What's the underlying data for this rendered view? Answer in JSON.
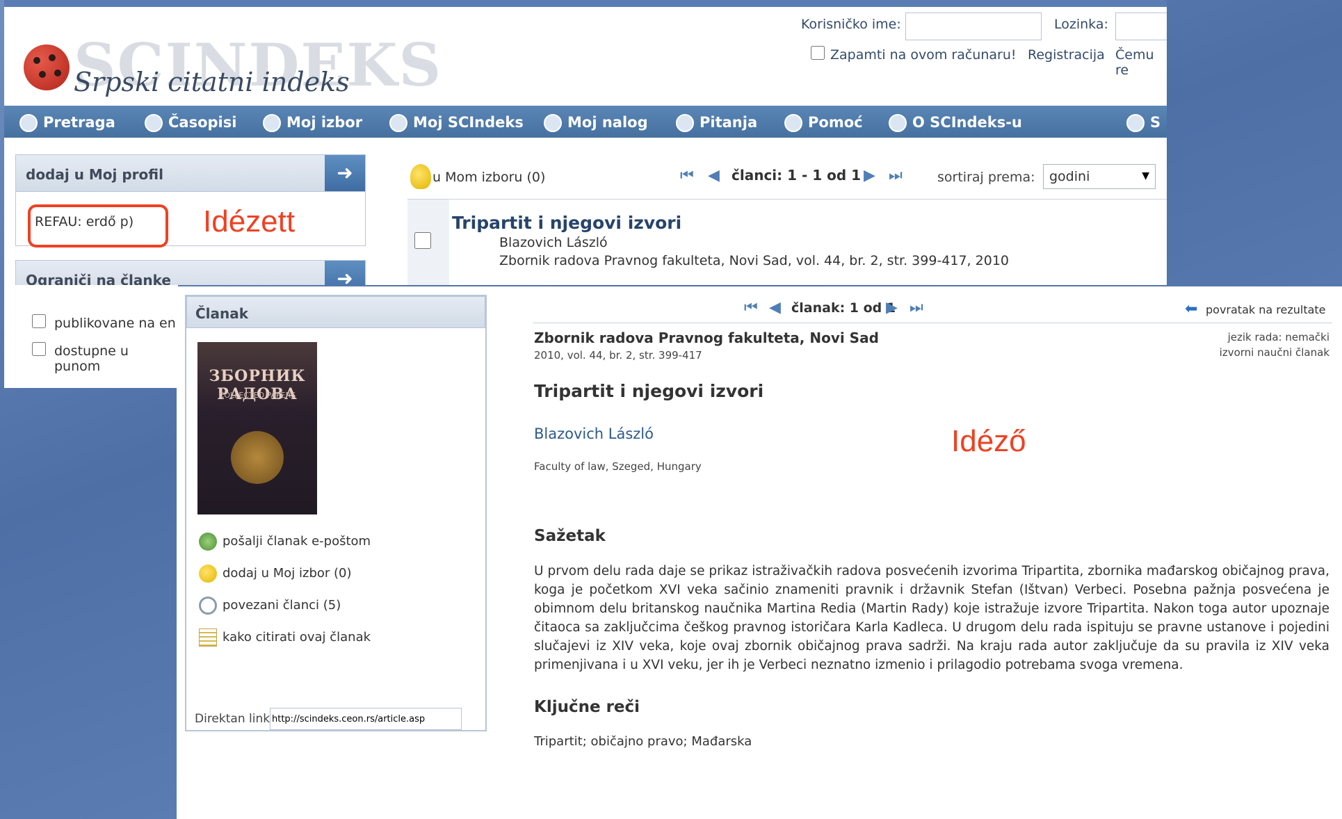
{
  "top": {
    "logo_text": "SCINDEKS",
    "logo_subtitle": "Srpski citatni indeks",
    "login": {
      "username_label": "Korisničko ime:",
      "password_label": "Lozinka:",
      "remember_label": "Zapamti na ovom računaru!",
      "register_link": "Registracija",
      "why_link": "Čemu re"
    },
    "nav": [
      {
        "label": "Pretraga",
        "icon": "magnifier-icon"
      },
      {
        "label": "Časopisi",
        "icon": "books-icon"
      },
      {
        "label": "Moj izbor",
        "icon": "pushpin-icon"
      },
      {
        "label": "Moj SCIndeks",
        "icon": "person-icon"
      },
      {
        "label": "Moj nalog",
        "icon": "account-icon"
      },
      {
        "label": "Pitanja",
        "icon": "question-icon"
      },
      {
        "label": "Pomoć",
        "icon": "plus-help-icon"
      },
      {
        "label": "O SCIndeks-u",
        "icon": "gear-icon"
      },
      {
        "label": "S",
        "icon": "globe-icon"
      }
    ],
    "profile_box": {
      "header": "dodaj u Moj profil",
      "query": "REFAU: erdő p)"
    },
    "limit_box": {
      "header": "Ograniči na članke",
      "options": [
        "publikovane na en",
        "dostupne u punom"
      ]
    },
    "results_toolbar": {
      "selection": "u Mom izboru (0)",
      "pager": "članci: 1 - 1 od 1",
      "sort_label": "sortiraj prema:",
      "sort_value": "godini"
    },
    "result": {
      "title": "Tripartit i njegovi izvori",
      "author": "Blazovich László",
      "source": "Zbornik radova Pravnog fakulteta, Novi Sad, vol. 44, br. 2, str. 399-417, 2010"
    }
  },
  "article": {
    "panel_header": "Članak",
    "cover_title": "ЗБОРНИК РАДОВА",
    "cover_subtitle": "COLLECTED PAPERS",
    "side_links": [
      {
        "label": "pošalji članak e-poštom",
        "icon": "email-person-icon"
      },
      {
        "label": "dodaj u Moj izbor (0)",
        "icon": "pushpin-icon"
      },
      {
        "label": "povezani članci (5)",
        "icon": "link-icon"
      },
      {
        "label": "kako citirati ovaj članak",
        "icon": "document-list-icon"
      }
    ],
    "direct_link_label": "Direktan link",
    "direct_link_value": "http://scindeks.ceon.rs/article.asp",
    "pager": "članak: 1 od 1",
    "back_link": "povratak na rezultate",
    "journal": "Zbornik radova Pravnog fakulteta, Novi Sad",
    "citation": "2010, vol. 44, br. 2, str. 399-417",
    "language": "jezik rada: nemački",
    "type": "izvorni naučni članak",
    "title": "Tripartit i njegovi izvori",
    "author": "Blazovich László",
    "affiliation": "Faculty of law, Szeged, Hungary",
    "abstract_heading": "Sažetak",
    "abstract": "U prvom delu rada daje se prikaz istraživačkih radova posvećenih izvorima Tripartita, zbornika mađarskog običajnog prava, koga je početkom XVI veka sačinio znameniti pravnik i državnik Stefan (Ištvan) Verbeci. Posebna pažnja posvećena je obimnom delu britanskog naučnika Martina Redia (Martin Rady) koje istražuje izvore Tripartita. Nakon toga autor upoznaje čitaoca sa zaključcima češkog pravnog istoričara Karla Kadleca. U drugom delu rada ispituju se pravne ustanove i pojedini slučajevi iz XIV veka, koje ovaj zbornik običajnog prava sadrži. Na kraju rada autor zaključuje da su pravila iz XIV veka primenjivana i u XVI veku, jer ih je Verbeci neznatno izmenio i prilagodio potrebama svoga vremena.",
    "keywords_heading": "Ključne reči",
    "keywords": "Tripartit; običajno pravo; Mađarska"
  },
  "annotations": {
    "cited_label": "Idézett",
    "citing_label": "Idéző",
    "accent_color": "#ef4123"
  }
}
